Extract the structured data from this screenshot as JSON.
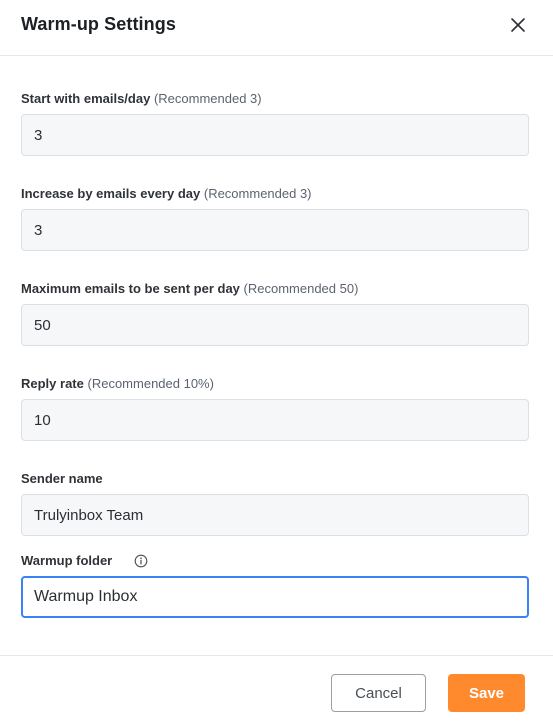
{
  "dialog": {
    "title": "Warm-up Settings"
  },
  "fields": [
    {
      "label": "Start with emails/day",
      "hint": "(Recommended 3)",
      "value": "3"
    },
    {
      "label": "Increase by emails every day",
      "hint": "(Recommended 3)",
      "value": "3"
    },
    {
      "label": "Maximum emails to be sent per day",
      "hint": "(Recommended 50)",
      "value": "50"
    },
    {
      "label": "Reply rate",
      "hint": "(Recommended 10%)",
      "value": "10"
    },
    {
      "label": "Sender name",
      "hint": "",
      "value": "Trulyinbox Team"
    },
    {
      "label": "Warmup folder",
      "hint": "",
      "value": "Warmup Inbox"
    }
  ],
  "buttons": {
    "cancel_label": "Cancel",
    "save_label": "Save"
  },
  "icons": {
    "close": "close-icon",
    "info": "info-icon"
  },
  "colors": {
    "accent": "#ff8a2e",
    "focus_border": "#3b82f6"
  }
}
